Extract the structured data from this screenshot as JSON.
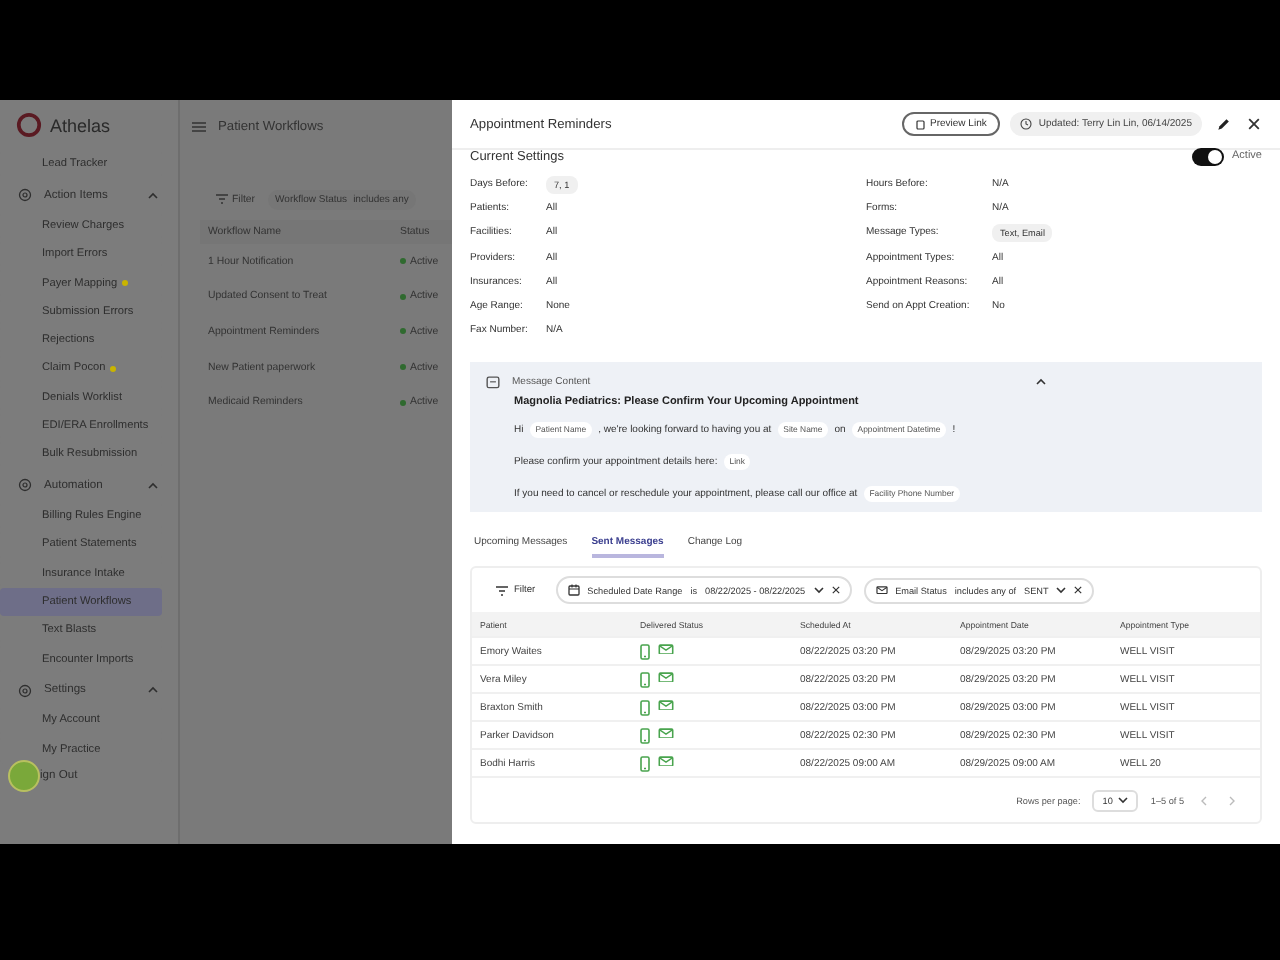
{
  "sidebar": {
    "brand": "Athelas",
    "top_items": [
      {
        "label": "Lead Tracker",
        "selected": false,
        "dot": false
      }
    ],
    "sections": [
      {
        "title": "Action Items",
        "expanded": true,
        "items": [
          {
            "label": "Review Charges",
            "selected": false,
            "dot": false
          },
          {
            "label": "Import Errors",
            "selected": false,
            "dot": false
          },
          {
            "label": "Payer Mapping",
            "selected": false,
            "dot": true
          },
          {
            "label": "Submission Errors",
            "selected": false,
            "dot": false
          },
          {
            "label": "Rejections",
            "selected": false,
            "dot": false
          },
          {
            "label": "Claim Pocon",
            "selected": false,
            "dot": true
          },
          {
            "label": "Denials Worklist",
            "selected": false,
            "dot": false
          },
          {
            "label": "EDI/ERA Enrollments",
            "selected": false,
            "dot": false
          },
          {
            "label": "Bulk Resubmission",
            "selected": false,
            "dot": false
          }
        ]
      },
      {
        "title": "Automation",
        "expanded": true,
        "items": [
          {
            "label": "Billing Rules Engine",
            "selected": false,
            "dot": false
          },
          {
            "label": "Patient Statements",
            "selected": false,
            "dot": false
          },
          {
            "label": "Insurance Intake",
            "selected": false,
            "dot": false
          },
          {
            "label": "Patient Workflows",
            "selected": true,
            "dot": false
          },
          {
            "label": "Text Blasts",
            "selected": false,
            "dot": false
          },
          {
            "label": "Encounter Imports",
            "selected": false,
            "dot": false
          }
        ]
      },
      {
        "title": "Settings",
        "expanded": true,
        "items": [
          {
            "label": "My Account",
            "selected": false,
            "dot": false
          },
          {
            "label": "My Practice",
            "selected": false,
            "dot": false
          }
        ]
      }
    ],
    "sign_out": "ign Out"
  },
  "page": {
    "title": "Patient Workflows",
    "filter": "Filter",
    "chip_label": "Workflow Status",
    "chip_op": "includes any",
    "columns": [
      "Workflow Name",
      "Status"
    ],
    "rows": [
      {
        "name": "1 Hour Notification",
        "status": "Active"
      },
      {
        "name": "Updated Consent to Treat",
        "status": "Active"
      },
      {
        "name": "Appointment Reminders",
        "status": "Active"
      },
      {
        "name": "New Patient paperwork",
        "status": "Active"
      },
      {
        "name": "Medicaid Reminders",
        "status": "Active"
      }
    ]
  },
  "drawer": {
    "title": "Appointment Reminders",
    "preview": "Preview Link",
    "updated": "Updated: Terry Lin Lin, 06/14/2025",
    "settings_title": "Current Settings",
    "active": true,
    "active_label": "Active",
    "left": [
      {
        "label": "Days Before:",
        "value": "7, 1",
        "kind": "chip"
      },
      {
        "label": "Patients:",
        "value": "All",
        "kind": "text"
      },
      {
        "label": "Facilities:",
        "value": "All",
        "kind": "text"
      },
      {
        "label": "Providers:",
        "value": "All",
        "kind": "text"
      },
      {
        "label": "Insurances:",
        "value": "All",
        "kind": "text"
      },
      {
        "label": "Age Range:",
        "value": "None",
        "kind": "text"
      },
      {
        "label": "Fax Number:",
        "value": "N/A",
        "kind": "text"
      }
    ],
    "right": [
      {
        "label": "Hours Before:",
        "value": "N/A",
        "kind": "text"
      },
      {
        "label": "Forms:",
        "value": "N/A",
        "kind": "text"
      },
      {
        "label": "Message Types:",
        "value": "Text, Email",
        "kind": "chip"
      },
      {
        "label": "Appointment Types:",
        "value": "All",
        "kind": "text"
      },
      {
        "label": "Appointment Reasons:",
        "value": "All",
        "kind": "text"
      },
      {
        "label": "Send on Appt Creation:",
        "value": "No",
        "kind": "text"
      }
    ],
    "message": {
      "title": "Message Content",
      "expanded": true,
      "subject": "Magnolia Pediatrics: Please Confirm Your Upcoming Appointment",
      "lines": [
        [
          {
            "kind": "text",
            "text": "Hi"
          },
          {
            "kind": "chip",
            "text": "Patient Name"
          },
          {
            "kind": "text",
            "text": ", we're looking forward to having you at"
          },
          {
            "kind": "chip",
            "text": "Site Name"
          },
          {
            "kind": "text",
            "text": "on"
          },
          {
            "kind": "chip",
            "text": "Appointment Datetime"
          },
          {
            "kind": "text",
            "text": "!"
          }
        ],
        [
          {
            "kind": "text",
            "text": "Please confirm your appointment details here:"
          },
          {
            "kind": "chip",
            "text": "Link"
          }
        ],
        [
          {
            "kind": "text",
            "text": "If you need to cancel or reschedule your appointment, please call our office at"
          },
          {
            "kind": "chip",
            "text": "Facility Phone Number"
          }
        ]
      ]
    },
    "tabs": [
      {
        "label": "Upcoming Messages",
        "selected": false
      },
      {
        "label": "Sent Messages",
        "selected": true
      },
      {
        "label": "Change Log",
        "selected": false
      }
    ],
    "filter": "Filter",
    "chips": [
      {
        "label": "Scheduled Date Range",
        "op": "is",
        "value": "08/22/2025 - 08/22/2025",
        "kind": "calendar"
      },
      {
        "label": "Email Status",
        "op": "includes any of",
        "value": "SENT",
        "kind": "mail"
      }
    ],
    "columns": [
      "Patient",
      "Delivered Status",
      "Scheduled At",
      "Appointment Date",
      "Appointment Type"
    ],
    "rows": [
      {
        "patient": "Emory Waites",
        "scheduled": "08/22/2025 03:20 PM",
        "appointment": "08/29/2025 03:20 PM",
        "type": "WELL VISIT"
      },
      {
        "patient": "Vera Miley",
        "scheduled": "08/22/2025 03:20 PM",
        "appointment": "08/29/2025 03:20 PM",
        "type": "WELL VISIT"
      },
      {
        "patient": "Braxton Smith",
        "scheduled": "08/22/2025 03:00 PM",
        "appointment": "08/29/2025 03:00 PM",
        "type": "WELL VISIT"
      },
      {
        "patient": "Parker Davidson",
        "scheduled": "08/22/2025 02:30 PM",
        "appointment": "08/29/2025 02:30 PM",
        "type": "WELL VISIT"
      },
      {
        "patient": "Bodhi Harris",
        "scheduled": "08/22/2025 09:00 AM",
        "appointment": "08/29/2025 09:00 AM",
        "type": "WELL 20"
      }
    ],
    "rows_per_page_label": "Rows per page:",
    "rows_per_page": "10",
    "range": "1–5 of 5"
  }
}
